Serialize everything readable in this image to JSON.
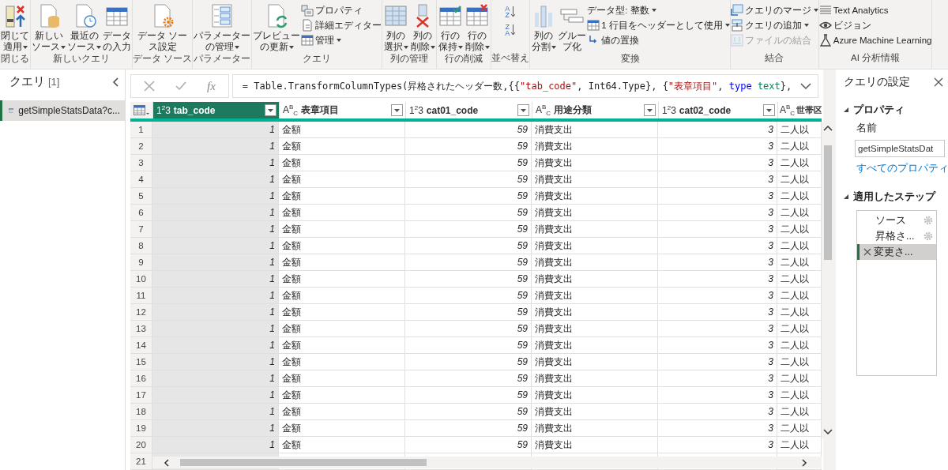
{
  "ribbon": {
    "groups": [
      {
        "label": "閉じる",
        "items": [
          {
            "kind": "large",
            "lines": [
              "閉じて",
              "適用"
            ],
            "dropdown": true
          }
        ]
      },
      {
        "label": "新しいクエリ",
        "items": [
          {
            "kind": "large",
            "lines": [
              "新しい",
              "ソース"
            ],
            "dropdown": true
          },
          {
            "kind": "large",
            "lines": [
              "最近の",
              "ソース"
            ],
            "dropdown": true
          },
          {
            "kind": "large",
            "lines": [
              "データ",
              "の入力"
            ],
            "dropdown": false
          }
        ]
      },
      {
        "label": "データ ソース",
        "items": [
          {
            "kind": "large",
            "lines": [
              "データ ソー",
              "ス設定"
            ],
            "dropdown": false
          }
        ]
      },
      {
        "label": "パラメーター",
        "items": [
          {
            "kind": "large",
            "lines": [
              "パラメーター",
              "の管理"
            ],
            "dropdown": true
          }
        ]
      },
      {
        "label": "クエリ",
        "items": [
          {
            "kind": "large",
            "lines": [
              "プレビュー",
              "の更新"
            ],
            "dropdown": true
          },
          {
            "kind": "stack",
            "items": [
              {
                "kind": "small",
                "label": "プロパティ",
                "dropdown": false,
                "disabled": false
              },
              {
                "kind": "small",
                "label": "詳細エディター",
                "dropdown": false,
                "disabled": false
              },
              {
                "kind": "small",
                "label": "管理",
                "dropdown": true,
                "disabled": false
              }
            ]
          }
        ]
      },
      {
        "label": "列の管理",
        "items": [
          {
            "kind": "large",
            "lines": [
              "列の",
              "選択"
            ],
            "dropdown": true
          },
          {
            "kind": "large",
            "lines": [
              "列の",
              "削除"
            ],
            "dropdown": true
          }
        ]
      },
      {
        "label": "行の削減",
        "items": [
          {
            "kind": "large",
            "lines": [
              "行の",
              "保持"
            ],
            "dropdown": true
          },
          {
            "kind": "large",
            "lines": [
              "行の",
              "削除"
            ],
            "dropdown": true
          }
        ]
      },
      {
        "label": "並べ替え",
        "items": [
          {
            "kind": "stack",
            "items": [
              {
                "kind": "sort",
                "top": "A",
                "bottom": "Z"
              },
              {
                "kind": "sort",
                "top": "Z",
                "bottom": "A"
              }
            ]
          }
        ]
      },
      {
        "label": "変換",
        "items": [
          {
            "kind": "large",
            "lines": [
              "列の",
              "分割"
            ],
            "dropdown": true
          },
          {
            "kind": "large",
            "lines": [
              "グルー",
              "プ化"
            ],
            "dropdown": false
          },
          {
            "kind": "stack",
            "items": [
              {
                "kind": "small",
                "label": "データ型: 整数",
                "dropdown": true,
                "disabled": false
              },
              {
                "kind": "small",
                "label": "1 行目をヘッダーとして使用",
                "dropdown": true,
                "disabled": false
              },
              {
                "kind": "small",
                "label": "値の置換",
                "dropdown": false,
                "disabled": false
              }
            ]
          }
        ]
      },
      {
        "label": "結合",
        "items": [
          {
            "kind": "stack",
            "items": [
              {
                "kind": "small",
                "label": "クエリのマージ",
                "dropdown": true,
                "disabled": false
              },
              {
                "kind": "small",
                "label": "クエリの追加",
                "dropdown": true,
                "disabled": false
              },
              {
                "kind": "small",
                "label": "ファイルの結合",
                "dropdown": false,
                "disabled": true
              }
            ]
          }
        ]
      },
      {
        "label": "AI 分析情報",
        "items": [
          {
            "kind": "stack",
            "items": [
              {
                "kind": "small",
                "label": "Text Analytics",
                "dropdown": false,
                "disabled": false
              },
              {
                "kind": "small",
                "label": "ビジョン",
                "dropdown": false,
                "disabled": false
              },
              {
                "kind": "small",
                "label": "Azure Machine Learning",
                "dropdown": false,
                "disabled": false
              }
            ]
          }
        ]
      }
    ]
  },
  "queries_pane": {
    "title": "クエリ",
    "count": "[1]",
    "items": [
      {
        "label": "getSimpleStatsData?c...",
        "selected": true
      }
    ]
  },
  "formula_bar": {
    "fx": "fx",
    "segments": [
      {
        "kind": "plain",
        "text": "= Table.TransformColumnTypes(昇格されたヘッダー数,{{"
      },
      {
        "kind": "string",
        "text": "\"tab_code\""
      },
      {
        "kind": "plain",
        "text": ", Int64.Type}, {"
      },
      {
        "kind": "string",
        "text": "\"表章項目\""
      },
      {
        "kind": "plain",
        "text": ", "
      },
      {
        "kind": "keyword",
        "text": "type"
      },
      {
        "kind": "typename",
        "text": " text"
      },
      {
        "kind": "plain",
        "text": "},"
      }
    ]
  },
  "table": {
    "columns": [
      {
        "numeric": true,
        "type_label": "1$^{2}$3",
        "name": "tab_code",
        "selected": true
      },
      {
        "numeric": false,
        "type_label": "A$^{B}$$_{C}$",
        "name": "表章項目",
        "selected": false
      },
      {
        "numeric": true,
        "type_label": "1$^{2}$3",
        "name": "cat01_code",
        "selected": false
      },
      {
        "numeric": false,
        "type_label": "A$^{B}$$_{C}$",
        "name": "用途分類",
        "selected": false
      },
      {
        "numeric": true,
        "type_label": "1$^{2}$3",
        "name": "cat02_code",
        "selected": false
      },
      {
        "numeric": false,
        "type_label": "A$^{B}$$_{C}$",
        "name": "世帯区",
        "selected": false
      }
    ],
    "rows": [
      {
        "index": "1",
        "cells": [
          "1",
          "金額",
          "59",
          "消費支出",
          "3",
          "二人以"
        ]
      },
      {
        "index": "2",
        "cells": [
          "1",
          "金額",
          "59",
          "消費支出",
          "3",
          "二人以"
        ]
      },
      {
        "index": "3",
        "cells": [
          "1",
          "金額",
          "59",
          "消費支出",
          "3",
          "二人以"
        ]
      },
      {
        "index": "4",
        "cells": [
          "1",
          "金額",
          "59",
          "消費支出",
          "3",
          "二人以"
        ]
      },
      {
        "index": "5",
        "cells": [
          "1",
          "金額",
          "59",
          "消費支出",
          "3",
          "二人以"
        ]
      },
      {
        "index": "6",
        "cells": [
          "1",
          "金額",
          "59",
          "消費支出",
          "3",
          "二人以"
        ]
      },
      {
        "index": "7",
        "cells": [
          "1",
          "金額",
          "59",
          "消費支出",
          "3",
          "二人以"
        ]
      },
      {
        "index": "8",
        "cells": [
          "1",
          "金額",
          "59",
          "消費支出",
          "3",
          "二人以"
        ]
      },
      {
        "index": "9",
        "cells": [
          "1",
          "金額",
          "59",
          "消費支出",
          "3",
          "二人以"
        ]
      },
      {
        "index": "10",
        "cells": [
          "1",
          "金額",
          "59",
          "消費支出",
          "3",
          "二人以"
        ]
      },
      {
        "index": "11",
        "cells": [
          "1",
          "金額",
          "59",
          "消費支出",
          "3",
          "二人以"
        ]
      },
      {
        "index": "12",
        "cells": [
          "1",
          "金額",
          "59",
          "消費支出",
          "3",
          "二人以"
        ]
      },
      {
        "index": "13",
        "cells": [
          "1",
          "金額",
          "59",
          "消費支出",
          "3",
          "二人以"
        ]
      },
      {
        "index": "14",
        "cells": [
          "1",
          "金額",
          "59",
          "消費支出",
          "3",
          "二人以"
        ]
      },
      {
        "index": "15",
        "cells": [
          "1",
          "金額",
          "59",
          "消費支出",
          "3",
          "二人以"
        ]
      },
      {
        "index": "16",
        "cells": [
          "1",
          "金額",
          "59",
          "消費支出",
          "3",
          "二人以"
        ]
      },
      {
        "index": "17",
        "cells": [
          "1",
          "金額",
          "59",
          "消費支出",
          "3",
          "二人以"
        ]
      },
      {
        "index": "18",
        "cells": [
          "1",
          "金額",
          "59",
          "消費支出",
          "3",
          "二人以"
        ]
      },
      {
        "index": "19",
        "cells": [
          "1",
          "金額",
          "59",
          "消費支出",
          "3",
          "二人以"
        ]
      },
      {
        "index": "20",
        "cells": [
          "1",
          "金額",
          "59",
          "消費支出",
          "3",
          "二人以"
        ]
      },
      {
        "index": "21"
      }
    ]
  },
  "settings": {
    "title": "クエリの設定",
    "properties_heading": "プロパティ",
    "name_label": "名前",
    "name_value": "getSimpleStatsDat",
    "all_properties_link": "すべてのプロパティ",
    "steps_heading": "適用したステップ",
    "steps": [
      {
        "label": "ソース",
        "has_settings": true,
        "selected": false
      },
      {
        "label": "昇格さ...",
        "has_settings": true,
        "selected": false
      },
      {
        "label": "変更さ...",
        "has_settings": false,
        "selected": true
      }
    ]
  }
}
